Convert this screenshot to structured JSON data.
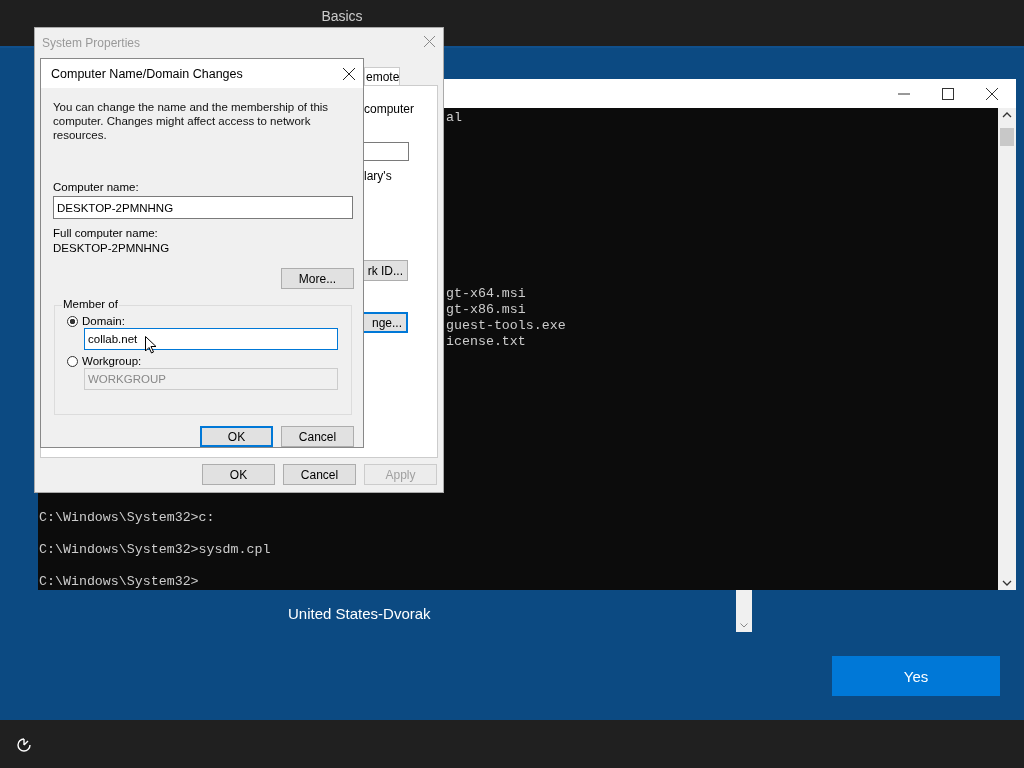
{
  "setup": {
    "heading": "Basics",
    "keyboard_layout": "United States-Dvorak",
    "yes_button": "Yes"
  },
  "console": {
    "top_line": "al",
    "file_lines": [
      "gt-x64.msi",
      "gt-x86.msi",
      "guest-tools.exe",
      "icense.txt"
    ],
    "lines_bottom": [
      "C:\\Windows\\System32>c:",
      "C:\\Windows\\System32>sysdm.cpl",
      "C:\\Windows\\System32>"
    ]
  },
  "system_properties": {
    "title": "System Properties",
    "tab": "emote",
    "panel_texts": [
      "computer",
      "lary's"
    ],
    "network_id_button": "rk ID...",
    "change_button": "nge...",
    "buttons": [
      {
        "label": "OK",
        "disabled": false
      },
      {
        "label": "Cancel",
        "disabled": false
      },
      {
        "label": "Apply",
        "disabled": true
      }
    ]
  },
  "name_dialog": {
    "title": "Computer Name/Domain Changes",
    "intro": "You can change the name and the membership of this computer. Changes might affect access to network resources.",
    "computer_name_label": "Computer name:",
    "computer_name": "DESKTOP-2PMNHNG",
    "full_name_label": "Full computer name:",
    "full_name": "DESKTOP-2PMNHNG",
    "more_button": "More...",
    "member_of": "Member of",
    "options": [
      {
        "label": "Domain:",
        "selected": true,
        "value": "collab.net"
      },
      {
        "label": "Workgroup:",
        "selected": false,
        "value": "WORKGROUP"
      }
    ],
    "buttons": [
      {
        "label": "OK",
        "focused": true
      },
      {
        "label": "Cancel",
        "focused": false
      }
    ]
  }
}
